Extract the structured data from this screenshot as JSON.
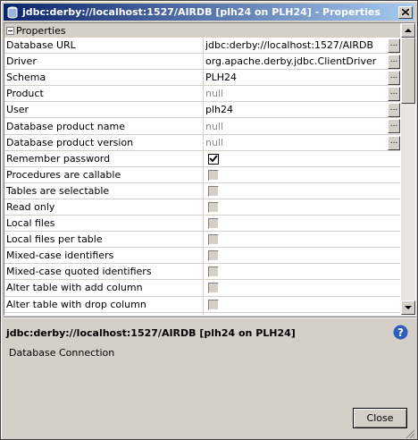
{
  "window": {
    "title": "jdbc:derby://localhost:1527/AIRDB [plh24 on PLH24] - Properties"
  },
  "sheet": {
    "category_label": "Properties",
    "ellipsis_label": "...",
    "rows": [
      {
        "name": "Database URL",
        "value": "jdbc:derby://localhost:1527/AIRDB",
        "kind": "text",
        "editor": true
      },
      {
        "name": "Driver",
        "value": "org.apache.derby.jdbc.ClientDriver",
        "kind": "text",
        "editor": true
      },
      {
        "name": "Schema",
        "value": "PLH24",
        "kind": "text",
        "editor": true
      },
      {
        "name": "Product",
        "value": "null",
        "kind": "null",
        "editor": true
      },
      {
        "name": "User",
        "value": "plh24",
        "kind": "text",
        "editor": true
      },
      {
        "name": "Database product name",
        "value": "null",
        "kind": "null",
        "editor": true
      },
      {
        "name": "Database product version",
        "value": "null",
        "kind": "null",
        "editor": true
      },
      {
        "name": "Remember password",
        "checked": true,
        "kind": "bool",
        "editor": false
      },
      {
        "name": "Procedures are callable",
        "checked": false,
        "kind": "bool",
        "editor": false
      },
      {
        "name": "Tables are selectable",
        "checked": false,
        "kind": "bool",
        "editor": false
      },
      {
        "name": "Read only",
        "checked": false,
        "kind": "bool",
        "editor": false
      },
      {
        "name": "Local files",
        "checked": false,
        "kind": "bool",
        "editor": false
      },
      {
        "name": "Local files per table",
        "checked": false,
        "kind": "bool",
        "editor": false
      },
      {
        "name": "Mixed-case identifiers",
        "checked": false,
        "kind": "bool",
        "editor": false
      },
      {
        "name": "Mixed-case quoted identifiers",
        "checked": false,
        "kind": "bool",
        "editor": false
      },
      {
        "name": "Alter table with add column",
        "checked": false,
        "kind": "bool",
        "editor": false
      },
      {
        "name": "Alter table with drop column",
        "checked": false,
        "kind": "bool",
        "editor": false
      },
      {
        "name": "",
        "checked": false,
        "kind": "bool",
        "editor": false
      }
    ]
  },
  "description": {
    "title": "jdbc:derby://localhost:1527/AIRDB [plh24 on PLH24]",
    "text": "Database Connection"
  },
  "buttons": {
    "close_label": "Close"
  },
  "colors": {
    "titlebar_start": "#0a246a",
    "titlebar_end": "#a6caf0",
    "face": "#d4d0c8",
    "null_text": "#8c8c8c"
  }
}
